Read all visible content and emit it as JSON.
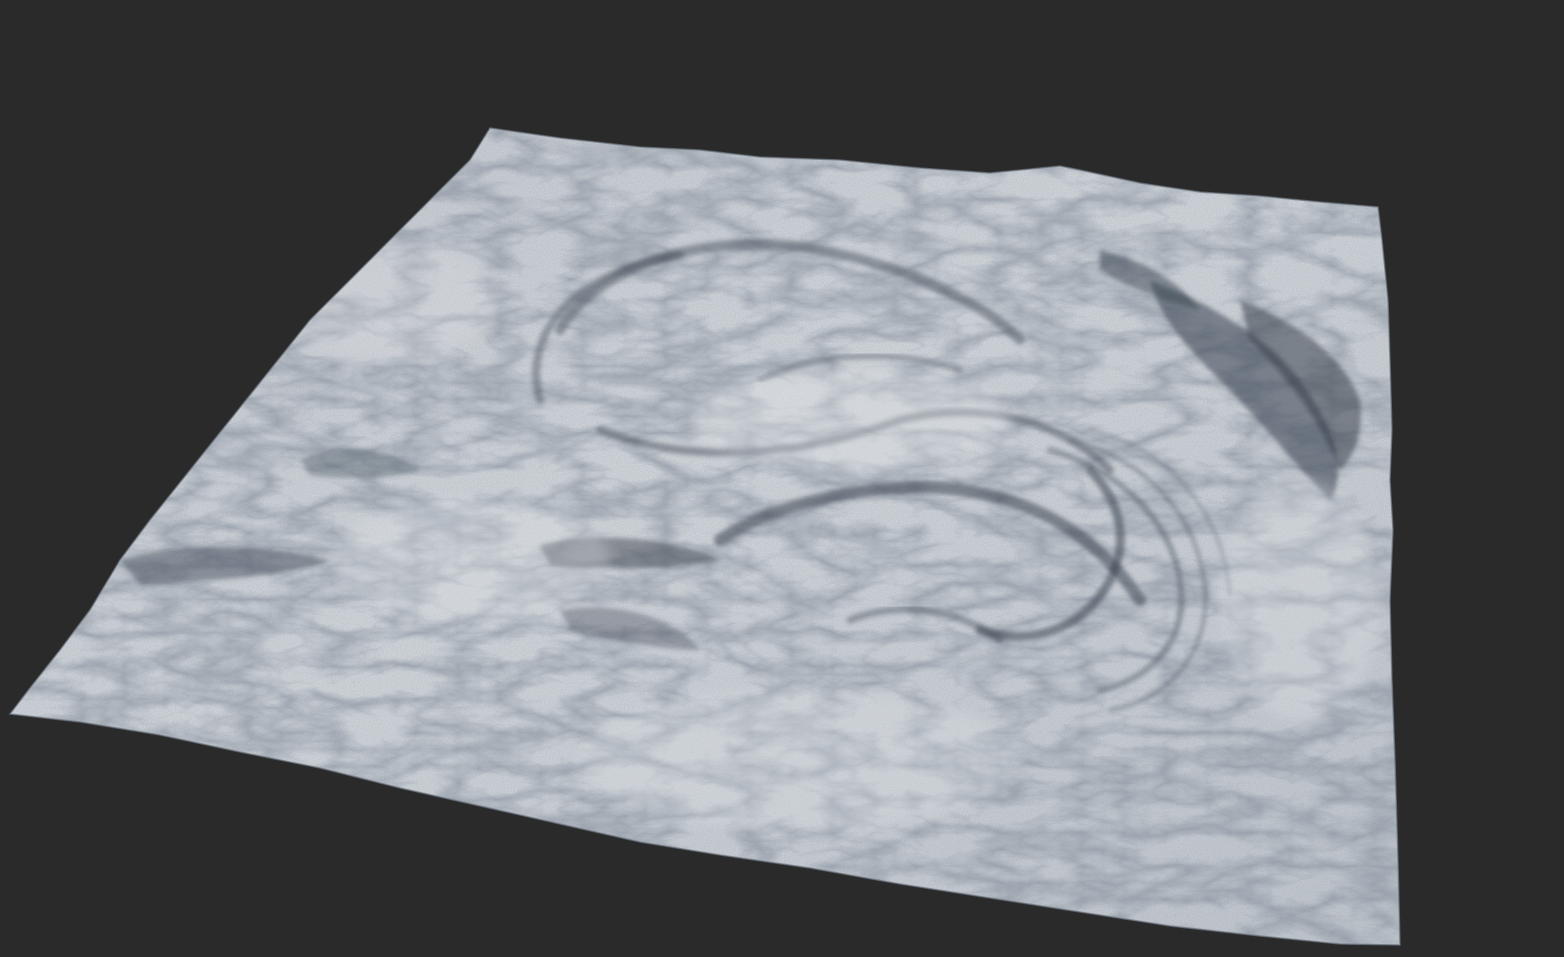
{
  "scene": {
    "subject": "terrain-heightmap-render",
    "colors": {
      "background": "#2a2a2b",
      "terrain_base": "#c9ced4",
      "terrain_highlight": "#e4e7ea",
      "terrain_shadow": "#4e5866",
      "terrain_deep_shadow": "#2f3844"
    }
  }
}
